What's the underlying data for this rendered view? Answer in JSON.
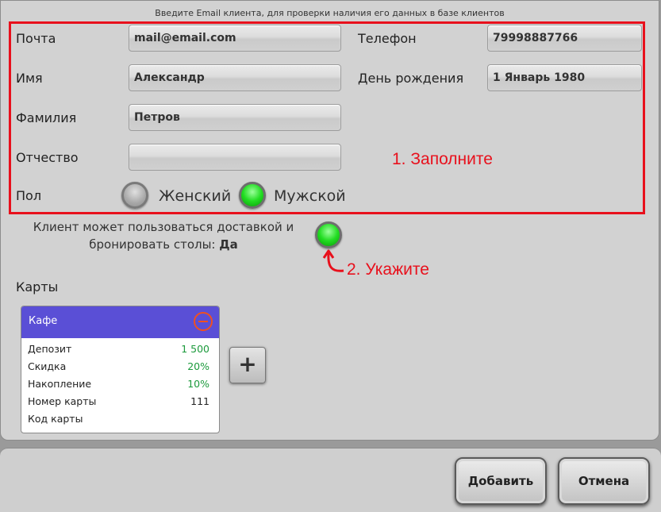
{
  "hint": "Введите Email клиента, для проверки наличия его данных в базе клиентов",
  "fields": {
    "email": {
      "label": "Почта",
      "value": "mail@email.com"
    },
    "phone": {
      "label": "Телефон",
      "value": "79998887766"
    },
    "first_name": {
      "label": "Имя",
      "value": "Александр"
    },
    "birthday": {
      "label": "День рождения",
      "value": "1 Январь 1980"
    },
    "last_name": {
      "label": "Фамилия",
      "value": "Петров"
    },
    "patronymic": {
      "label": "Отчество",
      "value": ""
    }
  },
  "gender": {
    "label": "Пол",
    "female": "Женский",
    "male": "Мужской",
    "selected": "male"
  },
  "annotations": {
    "fill": "1. Заполните",
    "specify": "2. Укажите"
  },
  "access": {
    "text": "Клиент может пользоваться доставкой и бронировать столы:",
    "value": "Да",
    "enabled": true
  },
  "cards": {
    "title": "Карты",
    "items": [
      {
        "name": "Кафе",
        "rows": [
          {
            "label": "Депозит",
            "value": "1 500"
          },
          {
            "label": "Скидка",
            "value": "20%"
          },
          {
            "label": "Накопление",
            "value": "10%"
          },
          {
            "label": "Номер карты",
            "value": "111"
          },
          {
            "label": "Код карты",
            "value": ""
          }
        ]
      }
    ],
    "add_label": "+"
  },
  "buttons": {
    "add": "Добавить",
    "cancel": "Отмена"
  },
  "colors": {
    "accent_red": "#e8101c",
    "card_header": "#5a4fd6",
    "value_green": "#1c9a3c",
    "radio_on": "#22dd22"
  }
}
